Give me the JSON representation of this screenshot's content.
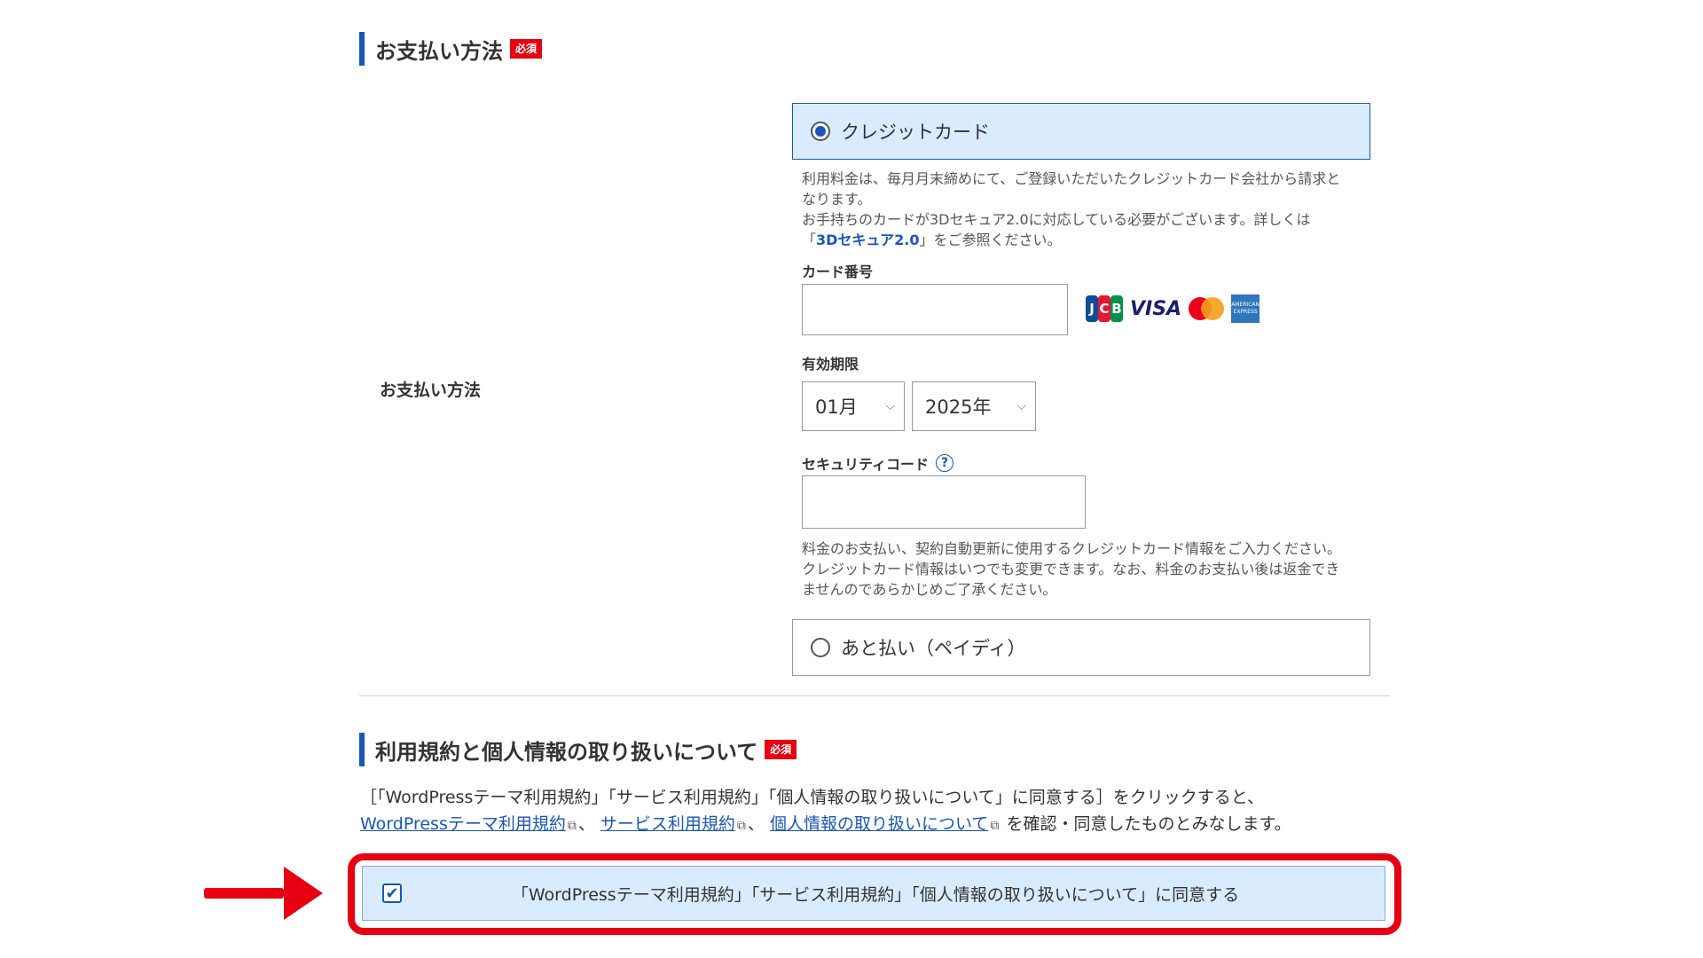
{
  "payment_section": {
    "heading": "お支払い方法",
    "required_badge": "必須",
    "row_label": "お支払い方法",
    "options": [
      {
        "label": "クレジットカード",
        "selected": true
      },
      {
        "label": "あと払い（ペイディ）",
        "selected": false
      }
    ],
    "credit_note_line1": "利用料金は、毎月月末締めにて、ご登録いただいたクレジットカード会社から請求と",
    "credit_note_line2": "なります。",
    "credit_note_line3": "お手持ちのカードが3Dセキュア2.0に対応している必要がございます。詳しくは",
    "credit_note_prefix": "「",
    "credit_note_link": "3Dセキュア2.0",
    "credit_note_suffix": "」をご参照ください。",
    "card_number_label": "カード番号",
    "card_number_value": "",
    "card_brands": [
      "JCB",
      "VISA",
      "Mastercard",
      "American Express"
    ],
    "brand_text": {
      "visa": "VISA",
      "amex_line1": "AMERICAN",
      "amex_line2": "EXPRESS"
    },
    "expiry_label": "有効期限",
    "expiry_month": "01月",
    "expiry_year": "2025年",
    "security_code_label": "セキュリティコード",
    "help_symbol": "?",
    "security_code_value": "",
    "card_info_note_line1": "料金のお支払い、契約自動更新に使用するクレジットカード情報をご入力ください。",
    "card_info_note_line2": "クレジットカード情報はいつでも変更できます。なお、料金のお支払い後は返金でき",
    "card_info_note_line3": "ませんのであらかじめご了承ください。"
  },
  "terms_section": {
    "heading": "利用規約と個人情報の取り扱いについて",
    "required_badge": "必須",
    "intro_line1": "［「WordPressテーマ利用規約」「サービス利用規約」「個人情報の取り扱いについて」に同意する］をクリックすると、",
    "link1": "WordPressテーマ利用規約",
    "sep1": "、",
    "link2": "サービス利用規約",
    "sep2": "、",
    "link3": "個人情報の取り扱いについて",
    "intro_suffix": "を確認・同意したものとみなします。",
    "agree_label": "「WordPressテーマ利用規約」「サービス利用規約」「個人情報の取り扱いについて」に同意する",
    "agree_checked": true,
    "check_symbol": "✔"
  },
  "colors": {
    "accent": "#1a56b8",
    "required_red": "#e60012",
    "selected_bg": "#d9ebff",
    "annotation_red": "#e60012"
  }
}
